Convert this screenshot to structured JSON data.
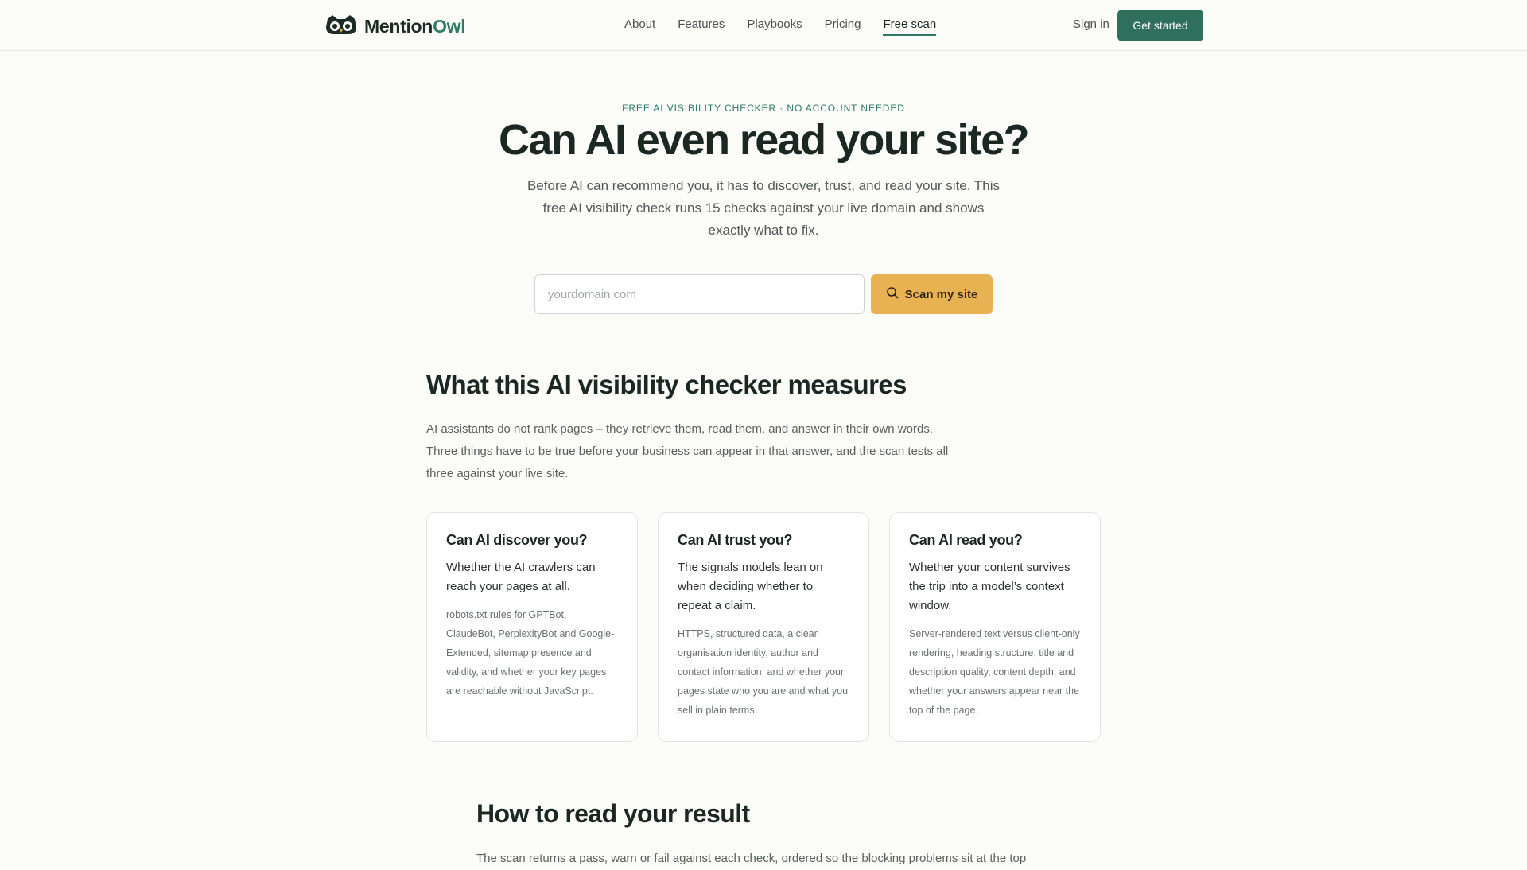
{
  "header": {
    "brand_main": "Mention",
    "brand_accent": "Owl",
    "nav": [
      {
        "label": "About"
      },
      {
        "label": "Features"
      },
      {
        "label": "Playbooks"
      },
      {
        "label": "Pricing"
      },
      {
        "label": "Free scan"
      }
    ],
    "active_nav": "Free scan",
    "signin_label": "Sign in",
    "cta_label": "Get started"
  },
  "hero": {
    "eyebrow": "FREE AI VISIBILITY CHECKER · NO ACCOUNT NEEDED",
    "title": "Can AI even read your site?",
    "subtitle": "Before AI can recommend you, it has to discover, trust, and read your site. This free AI visibility check runs 15 checks against your live domain and shows exactly what to fix.",
    "input_placeholder": "yourdomain.com",
    "input_value": "",
    "scan_label": "Scan my site",
    "scan_icon": "search-icon"
  },
  "measures": {
    "title": "What this AI visibility checker measures",
    "text": "AI assistants do not rank pages – they retrieve them, read them, and answer in their own words. Three things have to be true before your business can appear in that answer, and the scan tests all three against your live site.",
    "cards": [
      {
        "title": "Can AI discover you?",
        "lead": "Whether the AI crawlers can reach your pages at all.",
        "detail": "robots.txt rules for GPTBot, ClaudeBot, PerplexityBot and Google-Extended, sitemap presence and validity, and whether your key pages are reachable without JavaScript."
      },
      {
        "title": "Can AI trust you?",
        "lead": "The signals models lean on when deciding whether to repeat a claim.",
        "detail": "HTTPS, structured data, a clear organisation identity, author and contact information, and whether your pages state who you are and what you sell in plain terms."
      },
      {
        "title": "Can AI read you?",
        "lead": "Whether your content survives the trip into a model’s context window.",
        "detail": "Server-rendered text versus client-only rendering, heading structure, title and description quality, content depth, and whether your answers appear near the top of the page."
      }
    ]
  },
  "results": {
    "title": "How to read your result",
    "text": "The scan returns a pass, warn or fail against each check, ordered so the blocking problems sit at the top"
  },
  "colors": {
    "brand_green": "#2f6f5e",
    "accent_green": "#2f7a64",
    "scan_button": "#e8b253",
    "background": "#fbfbf8"
  }
}
